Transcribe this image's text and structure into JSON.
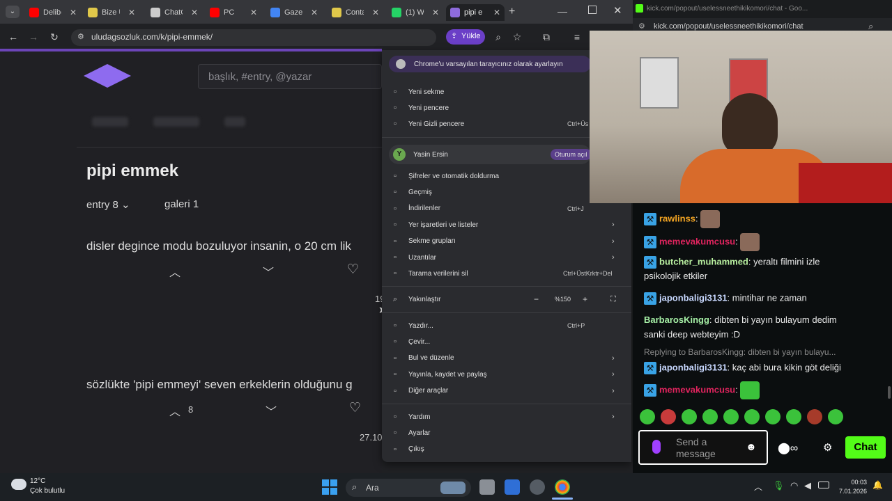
{
  "tabs": [
    {
      "label": "Delibe",
      "icon": "youtube-icon",
      "color": "#ff0000"
    },
    {
      "label": "Bize U",
      "icon": "p-icon",
      "color": "#e0c84a"
    },
    {
      "label": "ChatG",
      "icon": "openai-icon",
      "color": "#cccccc"
    },
    {
      "label": "PC",
      "icon": "youtube-icon",
      "color": "#ff0000"
    },
    {
      "label": "Gazete",
      "icon": "g-icon",
      "color": "#4285f4"
    },
    {
      "label": "Conta",
      "icon": "contact-icon",
      "color": "#e0c84a"
    },
    {
      "label": "(1) Wh",
      "icon": "whatsapp-icon",
      "color": "#25d366"
    },
    {
      "label": "pipi e",
      "icon": "u-icon",
      "color": "#8e6bdc"
    }
  ],
  "address": {
    "url": "uludagsozluk.com/k/pipi-emmek/",
    "yukle_label": "Yükle"
  },
  "page": {
    "search_placeholder": "başlık, #entry, @yazar",
    "title": "pipi emmek",
    "entry_count": "entry 8",
    "gallery": "galeri 1",
    "entries": [
      {
        "text": "disler degince modu bozuluyor insanin, o 20 cm lik",
        "partial_number": "19"
      },
      {
        "text": "sözlükte 'pipi emmeyi' seven erkeklerin olduğunu g",
        "votes": "8",
        "date": "27.10."
      }
    ]
  },
  "menu": {
    "default_banner": "Chrome'u varsayılan tarayıcınız olarak ayarlayın",
    "items_group1": [
      {
        "label": "Yeni sekme",
        "icon": "new-tab-icon",
        "shortcut": ""
      },
      {
        "label": "Yeni pencere",
        "icon": "new-window-icon",
        "shortcut": ""
      },
      {
        "label": "Yeni Gizli pencere",
        "icon": "incognito-icon",
        "shortcut": "Ctrl+Üs"
      }
    ],
    "profile": {
      "initial": "Y",
      "name": "Yasin Ersin",
      "status": "Oturum açıl"
    },
    "items_group2": [
      {
        "label": "Şifreler ve otomatik doldurma",
        "icon": "key-icon",
        "shortcut": "",
        "arrow": false
      },
      {
        "label": "Geçmiş",
        "icon": "history-icon",
        "shortcut": "",
        "arrow": false
      },
      {
        "label": "İndirilenler",
        "icon": "download-icon",
        "shortcut": "Ctrl+J",
        "arrow": false
      },
      {
        "label": "Yer işaretleri ve listeler",
        "icon": "star-icon",
        "shortcut": "",
        "arrow": true
      },
      {
        "label": "Sekme grupları",
        "icon": "tab-groups-icon",
        "shortcut": "",
        "arrow": true
      },
      {
        "label": "Uzantılar",
        "icon": "extensions-icon",
        "shortcut": "",
        "arrow": true
      },
      {
        "label": "Tarama verilerini sil",
        "icon": "trash-icon",
        "shortcut": "Ctrl+ÜstKrktr+Del",
        "arrow": false
      }
    ],
    "zoom": {
      "label": "Yakınlaştır",
      "value": "%150",
      "minus": "−",
      "plus": "+"
    },
    "items_group3": [
      {
        "label": "Yazdır...",
        "icon": "print-icon",
        "shortcut": "Ctrl+P",
        "arrow": false
      },
      {
        "label": "Çevir...",
        "icon": "translate-icon",
        "shortcut": "",
        "arrow": false
      },
      {
        "label": "Bul ve düzenle",
        "icon": "find-icon",
        "shortcut": "",
        "arrow": true
      },
      {
        "label": "Yayınla, kaydet ve paylaş",
        "icon": "share-icon",
        "shortcut": "",
        "arrow": true
      },
      {
        "label": "Diğer araçlar",
        "icon": "tools-icon",
        "shortcut": "",
        "arrow": true
      }
    ],
    "items_group4": [
      {
        "label": "Yardım",
        "icon": "help-icon",
        "arrow": true
      },
      {
        "label": "Ayarlar",
        "icon": "settings-icon",
        "arrow": false
      },
      {
        "label": "Çıkış",
        "icon": "exit-icon",
        "arrow": false
      }
    ]
  },
  "kick": {
    "window_title": "kick.com/popout/uselessneethikikomori/chat - Goo...",
    "url": "kick.com/popout/uselessneethikikomori/chat",
    "messages": [
      {
        "user": "rawlinss",
        "color": "#f5a623",
        "text": "",
        "emote": true
      },
      {
        "user": "memevakumcusu",
        "color": "#e0245e",
        "text": "",
        "emote": true
      },
      {
        "user": "butcher_muhammed",
        "color": "#b9f0a0",
        "text": "yeraltı filmini izle",
        "text2": "psikolojik etkiler"
      },
      {
        "user": "japonbaligi3131",
        "color": "#c8d8ff",
        "text": "mintihar ne zaman"
      },
      {
        "user": "BarbarosKingg",
        "color": "#a6f0a6",
        "text": "dibten bi yayın bulayum dedim",
        "text2": "sanki deep webteyim :D"
      },
      {
        "user": "japonbaligi3131",
        "color": "#c8d8ff",
        "text": "kaç abi bura kikin göt deliği",
        "reply": "Replying to BarbarosKingg: dibten bi yayın bulayu..."
      },
      {
        "user": "memevakumcusu",
        "color": "#e0245e",
        "text": "",
        "emote": true
      }
    ],
    "send_placeholder": "Send a message",
    "chat_button": "Chat",
    "accent": "#53fc18"
  },
  "taskbar": {
    "weather_temp": "12°C",
    "weather_desc": "Çok bulutlu",
    "search_label": "Ara",
    "time": "00:03",
    "date": "7.01.2026"
  }
}
